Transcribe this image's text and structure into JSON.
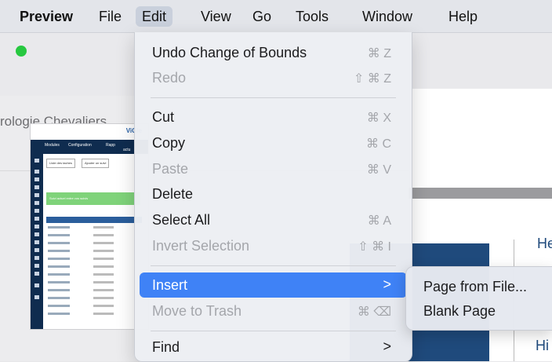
{
  "menubar": {
    "items": [
      "Preview",
      "File",
      "Edit",
      "View",
      "Go",
      "Tools",
      "Window",
      "Help"
    ]
  },
  "window": {
    "doc_title_partial": "rologie Chevaliers"
  },
  "thumbnail": {
    "logo": "ViGie",
    "nav": [
      "Modules",
      "Configuration",
      "Rapp",
      "actu"
    ],
    "buttons": [
      "Liste des taches",
      "Ajouter un suivi"
    ],
    "banner": "Suivi actuel entre vos suivis"
  },
  "edit_menu": {
    "undo": {
      "label": "Undo Change of Bounds",
      "shortcut": "⌘ Z"
    },
    "redo": {
      "label": "Redo",
      "shortcut": "⇧ ⌘ Z"
    },
    "cut": {
      "label": "Cut",
      "shortcut": "⌘ X"
    },
    "copy": {
      "label": "Copy",
      "shortcut": "⌘ C"
    },
    "paste": {
      "label": "Paste",
      "shortcut": "⌘ V"
    },
    "delete": {
      "label": "Delete"
    },
    "select_all": {
      "label": "Select All",
      "shortcut": "⌘ A"
    },
    "invert_selection": {
      "label": "Invert Selection",
      "shortcut": "⇧ ⌘ I"
    },
    "insert": {
      "label": "Insert",
      "chevron": ">"
    },
    "move_to_trash": {
      "label": "Move to Trash",
      "shortcut": "⌘ ⌫"
    },
    "find": {
      "label": "Find",
      "chevron": ">"
    }
  },
  "insert_submenu": {
    "page_from_file": "Page from File...",
    "blank_page": "Blank Page"
  },
  "content": {
    "heading_fragment_1": "He",
    "heading_fragment_2": "Hi"
  },
  "colors": {
    "highlight": "#3f82f6",
    "traffic_green": "#27c840",
    "doc_blue": "#1f4a7c"
  }
}
